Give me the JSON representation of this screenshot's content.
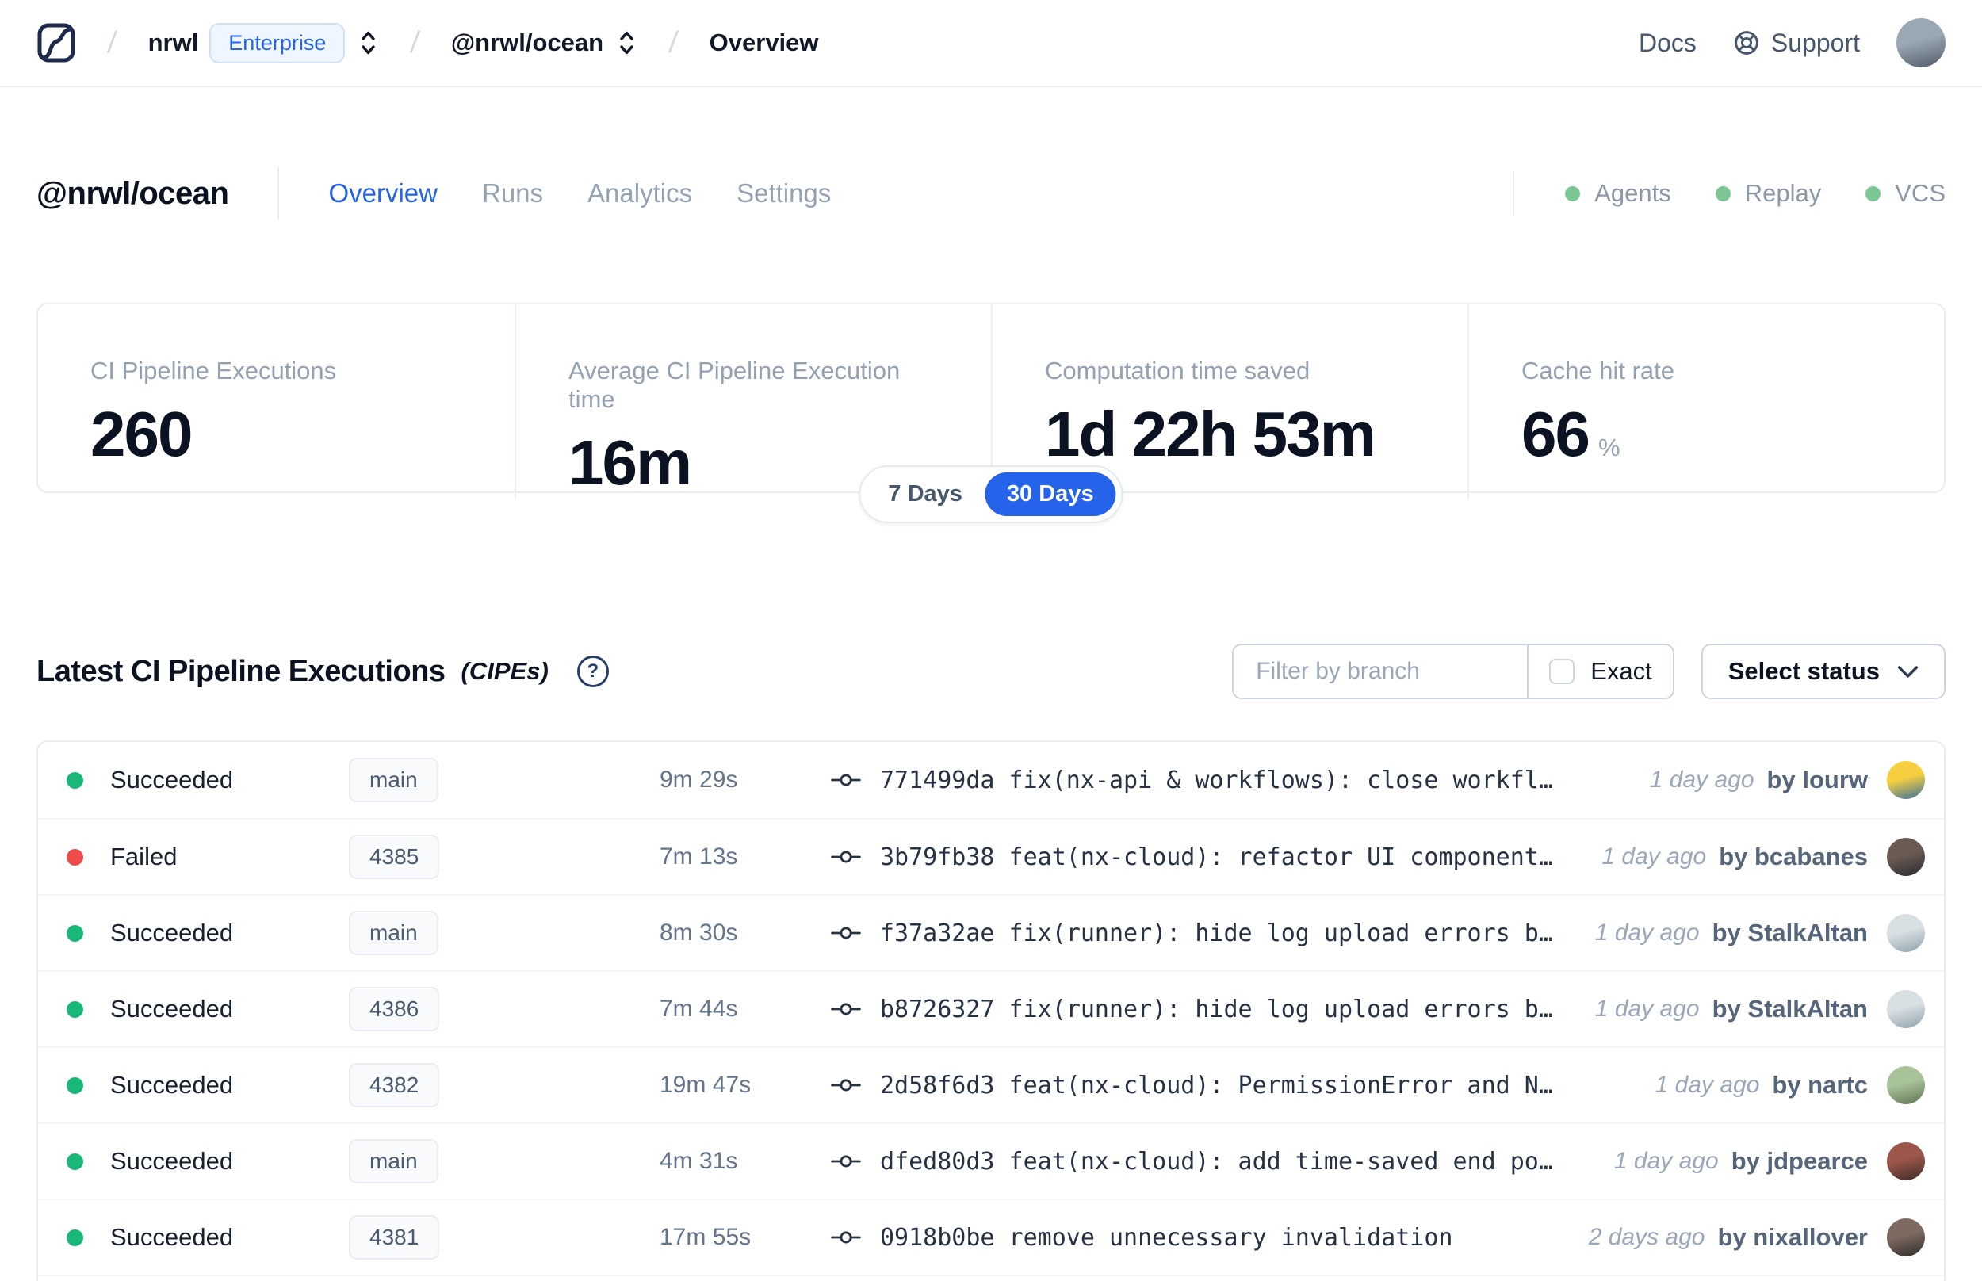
{
  "colors": {
    "accent_blue": "#2563eb",
    "success_green": "#19b87a",
    "failed_red": "#ee4b4b",
    "indicator_green": "#7cc694"
  },
  "navbar": {
    "org": "nrwl",
    "org_badge": "Enterprise",
    "workspace": "@nrwl/ocean",
    "page": "Overview",
    "docs_label": "Docs",
    "support_label": "Support",
    "avatar_colors": [
      "#9aa7b5",
      "#4f5b66"
    ]
  },
  "workspace_header": {
    "title": "@nrwl/ocean",
    "tabs": [
      {
        "label": "Overview",
        "active": true
      },
      {
        "label": "Runs",
        "active": false
      },
      {
        "label": "Analytics",
        "active": false
      },
      {
        "label": "Settings",
        "active": false
      }
    ],
    "indicators": [
      {
        "label": "Agents"
      },
      {
        "label": "Replay"
      },
      {
        "label": "VCS"
      }
    ]
  },
  "stats_cards": [
    {
      "label": "CI Pipeline Executions",
      "value": "260",
      "suffix": ""
    },
    {
      "label": "Average CI Pipeline Execution time",
      "value": "16m",
      "suffix": ""
    },
    {
      "label": "Computation time saved",
      "value": "1d 22h 53m",
      "suffix": ""
    },
    {
      "label": "Cache hit rate",
      "value": "66",
      "suffix": "%"
    }
  ],
  "range_toggle": {
    "options": [
      {
        "label": "7 Days",
        "active": false
      },
      {
        "label": "30 Days",
        "active": true
      }
    ]
  },
  "cipe_section": {
    "title": "Latest CI Pipeline Executions",
    "title_suffix": "(CIPEs)",
    "help_glyph": "?",
    "filter": {
      "placeholder": "Filter by branch",
      "exact_label": "Exact",
      "status_button": "Select status"
    },
    "rows": [
      {
        "status": "Succeeded",
        "status_color": "success",
        "branch": "main",
        "duration": "9m 29s",
        "commit": "771499da fix(nx-api & workflows): close workfl…",
        "time": "1 day ago",
        "author": "by lourw",
        "avatar_colors": [
          "#f5cf3f",
          "#3a6f9f"
        ]
      },
      {
        "status": "Failed",
        "status_color": "failed",
        "branch": "4385",
        "duration": "7m 13s",
        "commit": "3b79fb38 feat(nx-cloud): refactor UI component…",
        "time": "1 day ago",
        "author": "by bcabanes",
        "avatar_colors": [
          "#6b5a52",
          "#2b2b33"
        ]
      },
      {
        "status": "Succeeded",
        "status_color": "success",
        "branch": "main",
        "duration": "8m 30s",
        "commit": "f37a32ae fix(runner): hide log upload errors b…",
        "time": "1 day ago",
        "author": "by StalkAltan",
        "avatar_colors": [
          "#d9e0e4",
          "#8fa3ad"
        ]
      },
      {
        "status": "Succeeded",
        "status_color": "success",
        "branch": "4386",
        "duration": "7m 44s",
        "commit": "b8726327 fix(runner): hide log upload errors b…",
        "time": "1 day ago",
        "author": "by StalkAltan",
        "avatar_colors": [
          "#d9e0e4",
          "#8fa3ad"
        ]
      },
      {
        "status": "Succeeded",
        "status_color": "success",
        "branch": "4382",
        "duration": "19m 47s",
        "commit": "2d58f6d3 feat(nx-cloud): PermissionError and N…",
        "time": "1 day ago",
        "author": "by nartc",
        "avatar_colors": [
          "#a8c29a",
          "#5f7452"
        ]
      },
      {
        "status": "Succeeded",
        "status_color": "success",
        "branch": "main",
        "duration": "4m 31s",
        "commit": "dfed80d3 feat(nx-cloud): add time-saved end po…",
        "time": "1 day ago",
        "author": "by jdpearce",
        "avatar_colors": [
          "#9c564a",
          "#3a2b28"
        ]
      },
      {
        "status": "Succeeded",
        "status_color": "success",
        "branch": "4381",
        "duration": "17m 55s",
        "commit": "0918b0be remove unnecessary invalidation",
        "time": "2 days ago",
        "author": "by nixallover",
        "avatar_colors": [
          "#7d6a60",
          "#2f2a28"
        ]
      }
    ]
  }
}
